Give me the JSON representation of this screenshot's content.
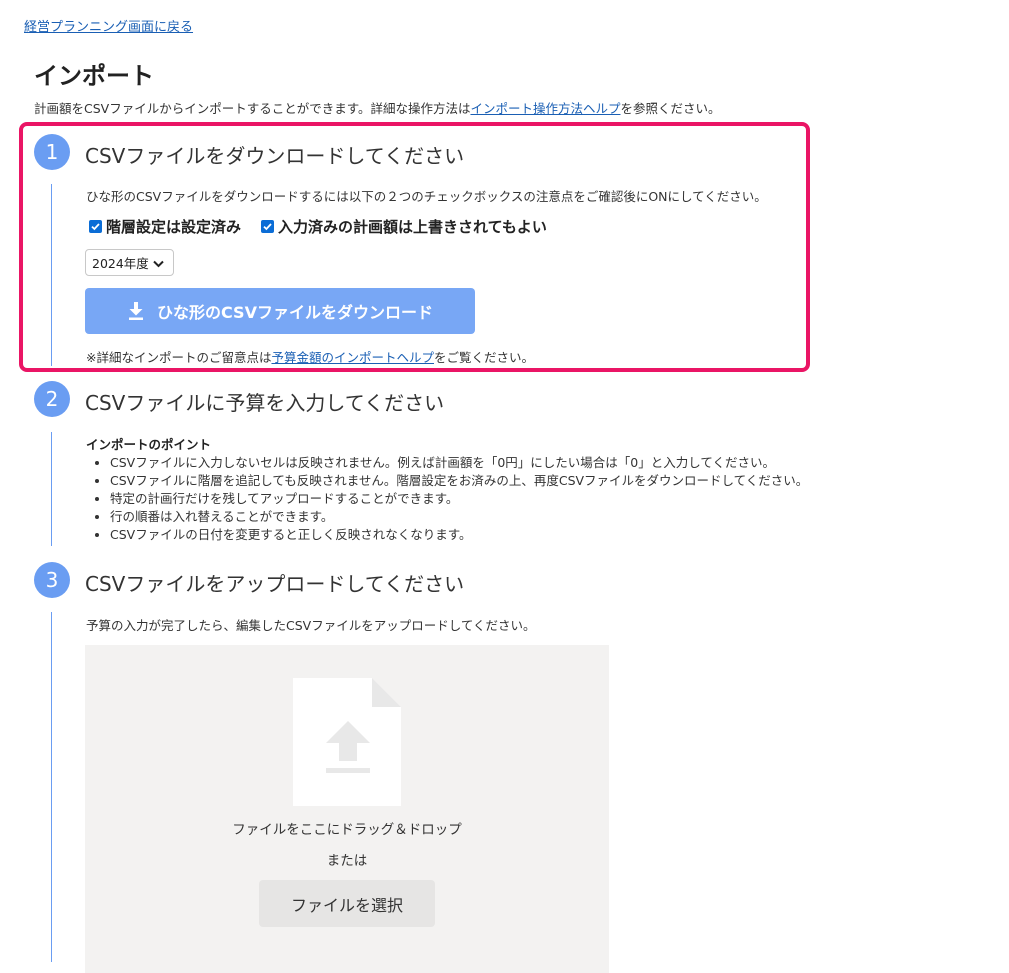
{
  "back_link": "経営プランニング画面に戻る",
  "page_title": "インポート",
  "intro": {
    "before": "計画額をCSVファイルからインポートすることができます。詳細な操作方法は",
    "link": "インポート操作方法ヘルプ",
    "after": "を参照ください。"
  },
  "step1": {
    "number": "1",
    "title": "CSVファイルをダウンロードしてください",
    "description": "ひな形のCSVファイルをダウンロードするには以下の２つのチェックボックスの注意点をご確認後にONにしてください。",
    "checkboxes": [
      {
        "label": "階層設定は設定済み",
        "checked": true
      },
      {
        "label": "入力済みの計画額は上書きされてもよい",
        "checked": true
      }
    ],
    "year_select": "2024年度",
    "download_button": "ひな形のCSVファイルをダウンロード",
    "note": {
      "before": "※詳細なインポートのご留意点は",
      "link": "予算金額のインポートヘルプ",
      "after": "をご覧ください。"
    }
  },
  "step2": {
    "number": "2",
    "title": "CSVファイルに予算を入力してください",
    "points_title": "インポートのポイント",
    "points": [
      "CSVファイルに入力しないセルは反映されません。例えば計画額を「0円」にしたい場合は「0」と入力してください。",
      "CSVファイルに階層を追記しても反映されません。階層設定をお済みの上、再度CSVファイルをダウンロードしてください。",
      "特定の計画行だけを残してアップロードすることができます。",
      "行の順番は入れ替えることができます。",
      "CSVファイルの日付を変更すると正しく反映されなくなります。"
    ]
  },
  "step3": {
    "number": "3",
    "title": "CSVファイルをアップロードしてください",
    "description": "予算の入力が完了したら、編集したCSVファイルをアップロードしてください。",
    "drop_text": "ファイルをここにドラッグ＆ドロップ",
    "or_text": "または",
    "select_button": "ファイルを選択"
  },
  "colors": {
    "accent": "#6a9df2",
    "highlight": "#ea1565",
    "download_button": "#78a7f5",
    "link": "#1a5fb4"
  },
  "icons": [
    "download-icon",
    "chevron-down-icon",
    "checkmark-icon",
    "file-upload-icon"
  ]
}
